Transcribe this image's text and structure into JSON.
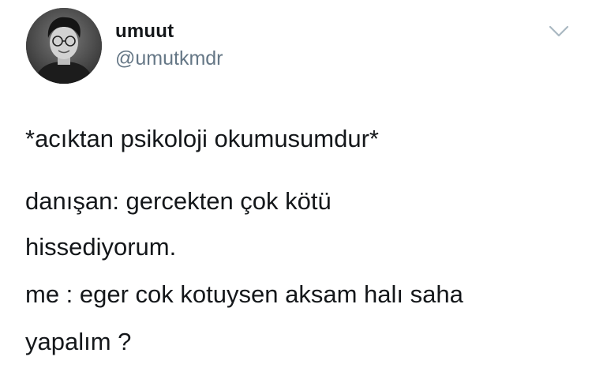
{
  "author": {
    "display_name": "umuut",
    "handle": "@umutkmdr"
  },
  "tweet": {
    "lines": [
      "*acıktan psikoloji okumusumdur*",
      "danışan: gercekten çok kötü",
      "hissediyorum.",
      "me : eger cok kotuysen aksam halı saha",
      "yapalım ?"
    ]
  },
  "icons": {
    "menu": "chevron-down-icon",
    "avatar": "profile-photo"
  },
  "colors": {
    "text": "#14171a",
    "secondary": "#657786",
    "chevron": "#aab8c2"
  }
}
